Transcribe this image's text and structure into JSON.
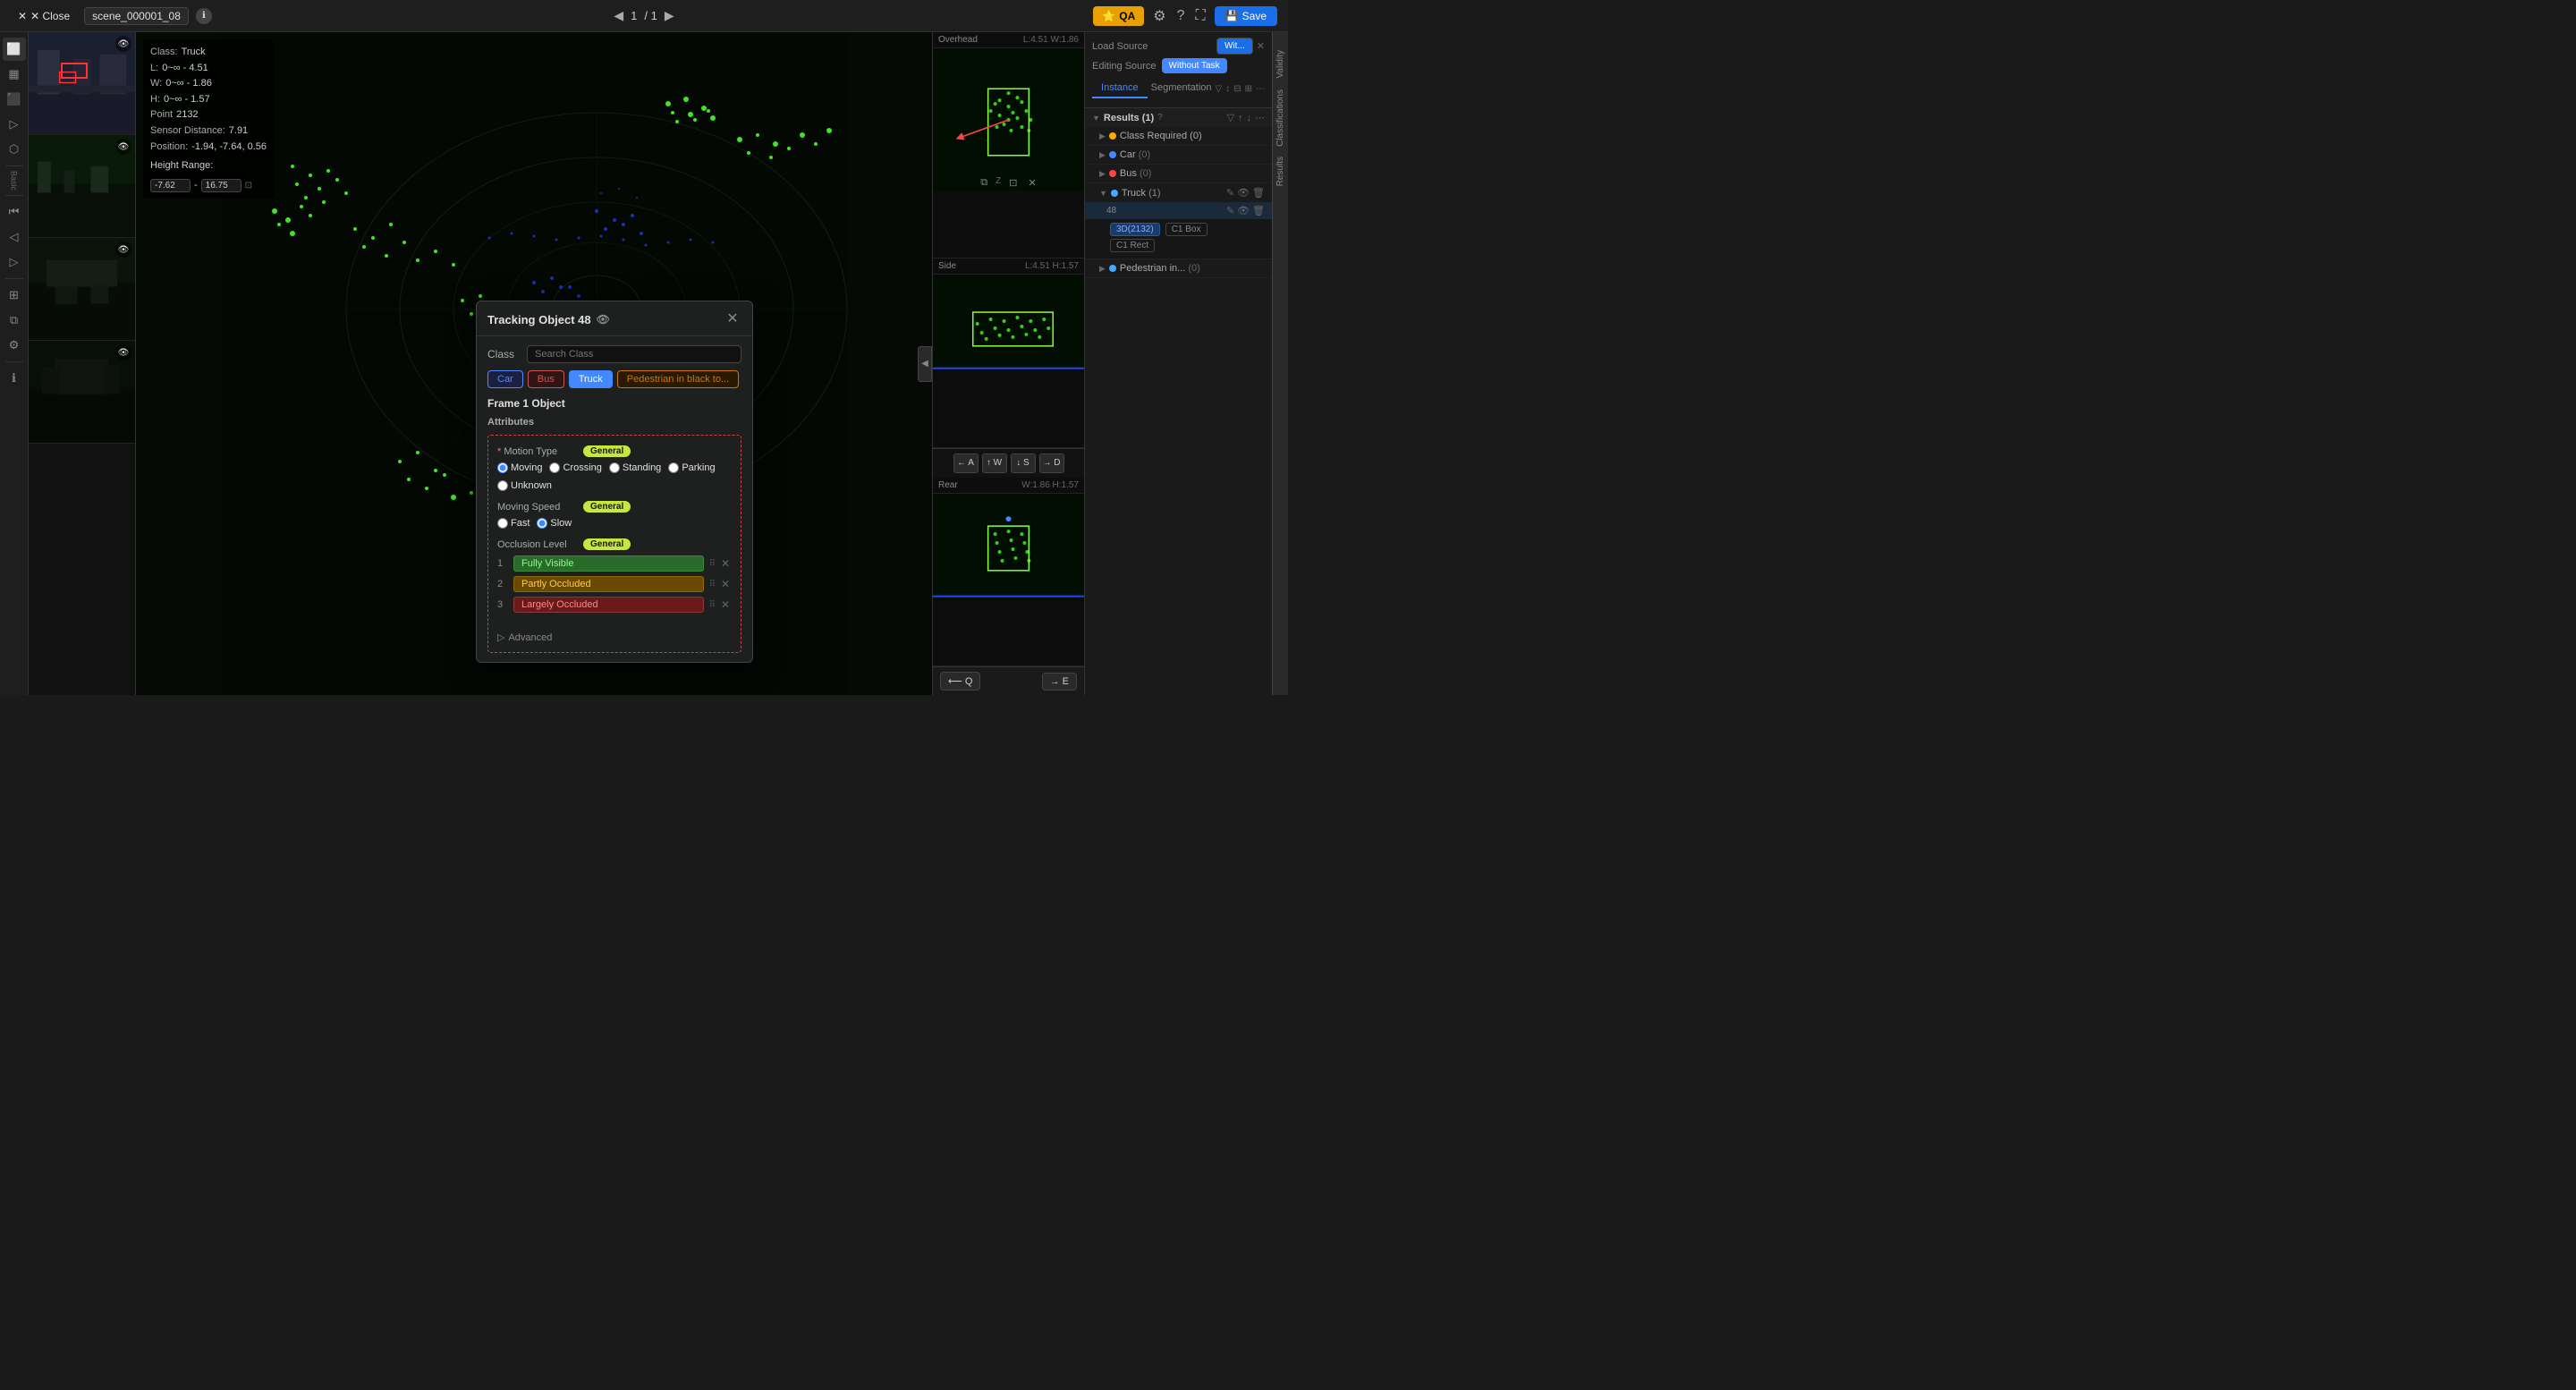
{
  "topbar": {
    "close_label": "✕ Close",
    "scene_name": "scene_000001_08",
    "info_icon": "ℹ",
    "page_current": "1",
    "page_total": "/ 1",
    "qa_label": "QA",
    "save_label": "Save"
  },
  "tools": {
    "items": [
      {
        "name": "3d-view-icon",
        "symbol": "⬜"
      },
      {
        "name": "camera-icon",
        "symbol": "▦"
      },
      {
        "name": "bev-icon",
        "symbol": "⬛"
      },
      {
        "name": "play-icon",
        "symbol": "▶"
      },
      {
        "name": "polygon-icon",
        "symbol": "⬡"
      }
    ],
    "basic_label": "Basic",
    "items2": [
      {
        "name": "skip-start-icon",
        "symbol": "⏮"
      },
      {
        "name": "prev-icon",
        "symbol": "◁"
      },
      {
        "name": "play2-icon",
        "symbol": "▷"
      },
      {
        "name": "next-icon",
        "symbol": "⬡"
      },
      {
        "name": "settings-icon",
        "symbol": "⚙"
      },
      {
        "name": "layers-icon",
        "symbol": "⧉"
      },
      {
        "name": "grid-icon",
        "symbol": "⊞"
      }
    ]
  },
  "info_overlay": {
    "class_label": "Class:",
    "class_value": "Truck",
    "l_label": "L:",
    "l_value": "0~∞ - 4.51",
    "w_label": "W:",
    "w_value": "0~∞ - 1.86",
    "h_label": "H:",
    "h_value": "0~∞ - 1.57",
    "point_label": "Point",
    "point_value": "2132",
    "sensor_label": "Sensor Distance:",
    "sensor_value": "7.91",
    "position_label": "Position:",
    "position_value": "-1.94, -7.64, 0.56",
    "height_range_label": "Height Range:",
    "height_min": "-7.62",
    "height_max": "16.75"
  },
  "tracking_dialog": {
    "title": "Tracking Object 48",
    "class_label": "Class",
    "search_placeholder": "Search Class",
    "class_buttons": [
      {
        "label": "Car",
        "type": "car"
      },
      {
        "label": "Bus",
        "type": "bus"
      },
      {
        "label": "Truck",
        "type": "truck"
      },
      {
        "label": "Pedestrian in black to...",
        "type": "pedestrian"
      }
    ],
    "frame_section": "Frame 1 Object",
    "attributes_label": "Attributes",
    "motion_type_label": "Motion Type",
    "motion_type_general": "General",
    "motion_options": [
      {
        "label": "Moving",
        "value": "moving",
        "checked": true
      },
      {
        "label": "Crossing",
        "value": "crossing",
        "checked": false
      },
      {
        "label": "Standing",
        "value": "standing",
        "checked": false
      },
      {
        "label": "Parking",
        "value": "parking",
        "checked": false
      },
      {
        "label": "Unknown",
        "value": "unknown",
        "checked": false
      }
    ],
    "moving_speed_label": "Moving Speed",
    "moving_speed_general": "General",
    "speed_options": [
      {
        "label": "Fast",
        "value": "fast",
        "checked": false
      },
      {
        "label": "Slow",
        "value": "slow",
        "checked": true
      }
    ],
    "occlusion_label": "Occlusion Level",
    "occlusion_general": "General",
    "occlusion_items": [
      {
        "num": "1",
        "label": "Fully Visible",
        "type": "green"
      },
      {
        "num": "2",
        "label": "Partly Occluded",
        "type": "orange"
      },
      {
        "num": "3",
        "label": "Largely Occluded",
        "type": "red"
      }
    ],
    "advanced_label": "Advanced"
  },
  "overhead_view": {
    "label": "Overhead",
    "dims": "L:4.51 W:1.86"
  },
  "side_view": {
    "label": "Side",
    "dims": "L:4.51 H:1.57"
  },
  "rear_view": {
    "label": "Rear",
    "dims": "W:1.86 H:1.57"
  },
  "wasd": {
    "a_label": "← A",
    "w_label": "↑ W",
    "s_label": "↓ S",
    "d_label": "→ D"
  },
  "results_panel": {
    "load_source_label": "Load Source",
    "load_source_tab": "Wit...",
    "editing_source_label": "Editing Source",
    "without_task_label": "Without Task",
    "instance_tab": "Instance",
    "segmentation_tab": "Segmentation",
    "results_label": "Results (1)",
    "class_required_label": "Class Required (0)",
    "classes": [
      {
        "label": "Car",
        "count": "(0)",
        "color": "blue"
      },
      {
        "label": "Bus",
        "count": "(0)",
        "color": "red"
      },
      {
        "label": "Truck",
        "count": "(1)",
        "color": "cyan",
        "expanded": true
      },
      {
        "label": "Pedestrian in...",
        "count": "(0)",
        "color": "blue"
      }
    ],
    "truck_item_num": "48",
    "sub_tags": [
      {
        "label": "3D(2132)",
        "type": "blue"
      },
      {
        "label": "C1 Box",
        "type": "outline"
      },
      {
        "label": "C1 Rect",
        "type": "outline"
      }
    ],
    "bottom_nav": {
      "zoom_in": "⟵ Q",
      "zoom_out": "→ E"
    }
  },
  "validity_labels": {
    "validity": "Validity",
    "classifications": "Classifications",
    "results": "Results"
  }
}
